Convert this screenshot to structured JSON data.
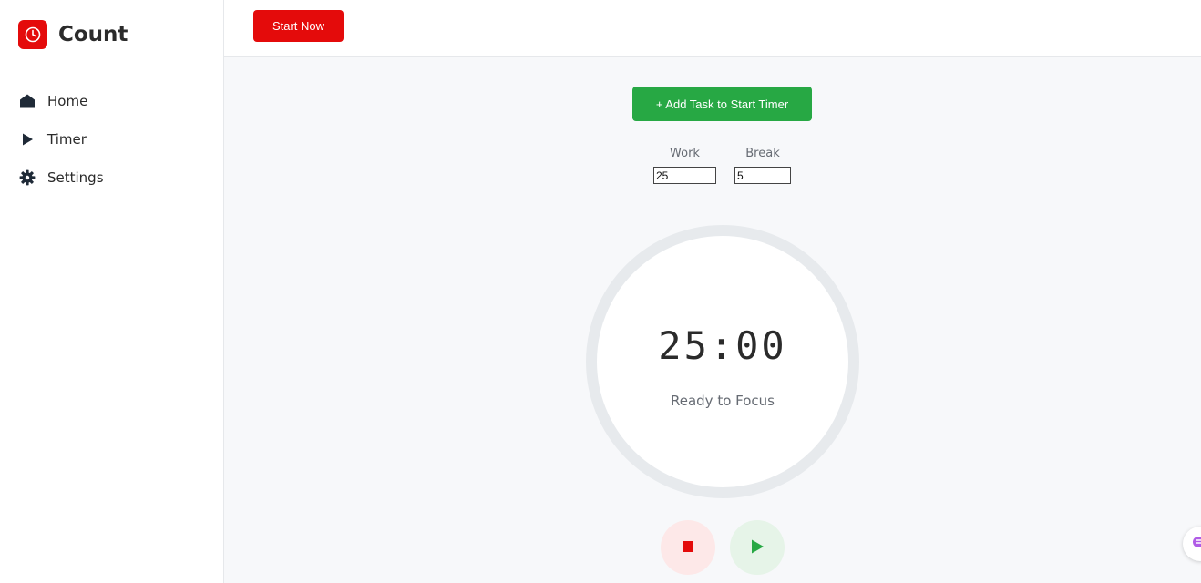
{
  "app": {
    "name": "Count",
    "brand_color": "#e40b0b",
    "logo_icon": "clock-icon"
  },
  "sidebar": {
    "items": [
      {
        "label": "Home",
        "icon": "home-icon"
      },
      {
        "label": "Timer",
        "icon": "play-icon"
      },
      {
        "label": "Settings",
        "icon": "gear-icon"
      }
    ]
  },
  "topbar": {
    "start_label": "Start Now"
  },
  "main": {
    "add_task_label": "+ Add Task to Start Timer",
    "work_label": "Work",
    "work_value": "25",
    "break_label": "Break",
    "break_value": "5",
    "time_display": "25:00",
    "status_text": "Ready to Focus",
    "success_color": "#27a844"
  },
  "controls": {
    "stop_icon": "stop-icon",
    "play_icon": "play-icon"
  }
}
